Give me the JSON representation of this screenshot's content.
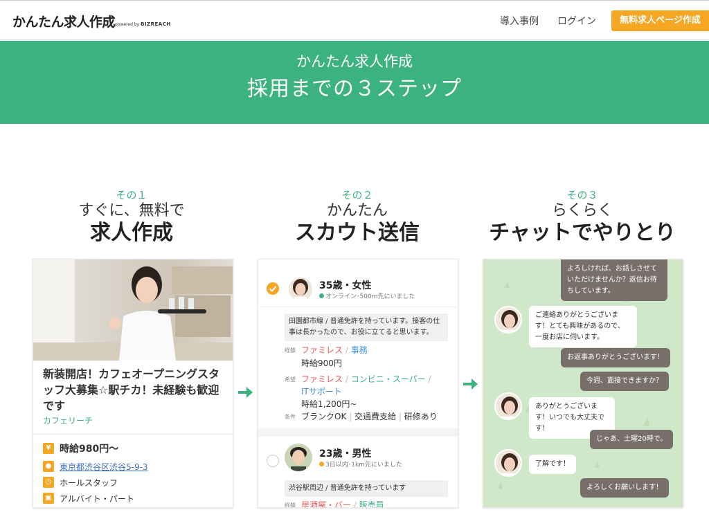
{
  "header": {
    "logo": "かんたん求人作成",
    "logo_powered": "powered by",
    "logo_brand": "BIZREACH",
    "nav_cases": "導入事例",
    "nav_login": "ログイン",
    "cta": "無料求人ページ作成"
  },
  "banner": {
    "subtitle": "かんたん求人作成",
    "title": "採用までの３ステップ"
  },
  "steps": [
    {
      "num": "その１",
      "sub": "すぐに、無料で",
      "main": "求人作成"
    },
    {
      "num": "その２",
      "sub": "かんたん",
      "main": "スカウト送信"
    },
    {
      "num": "その３",
      "sub": "らくらく",
      "main": "チャットでやりとり"
    }
  ],
  "job_card": {
    "title": "新装開店！カフェオープニングスタッフ大募集☆駅チカ！未経験も歓迎です",
    "company": "カフェリーチ",
    "wage": "時給980円〜",
    "address": "東京都渋谷区渋谷5-9-3",
    "position": "ホールスタッフ",
    "employment": "アルバイト・パート",
    "icons": [
      "yen-icon",
      "map-pin-icon",
      "clock-icon",
      "bag-icon"
    ]
  },
  "scout_card": {
    "candidates": [
      {
        "name": "35歳・女性",
        "status": "オンライン･500m先にいました",
        "status_color": "#3cb37f",
        "message": "田園都市線 / 普通免許を持っています。接客の仕事は長かったので、お役に立てると思います。",
        "exp_label": "経験",
        "exp_a": "ファミレス",
        "exp_sep": "/",
        "exp_b": "事務",
        "exp_wage": "時給900円",
        "wish_label": "希望",
        "wish_a": "ファミレス",
        "wish_sep1": "/",
        "wish_b": "コンビニ・スーパー",
        "wish_sep2": "/",
        "wish_c": "ITサポート",
        "wish_wage": "時給1,200円~",
        "cond_label": "条件",
        "cond": "ブランクOK",
        "cond_sep1": "|",
        "cond_b": "交通費支給",
        "cond_sep2": "|",
        "cond_c": "研修あり"
      },
      {
        "name": "23歳・男性",
        "status": "3日以内･1km先にいました",
        "status_color": "#f5a623",
        "message": "渋谷駅周辺 / 普通免許を持っています",
        "exp_label": "経験",
        "exp_a": "居酒屋・バー",
        "exp_sep": "/",
        "exp_b": "販売員"
      }
    ]
  },
  "chat_card": {
    "messages": [
      {
        "side": "right",
        "text": "よろしければ、お話しさせていただけませんか？返信お待ちしています。"
      },
      {
        "side": "left",
        "text": "ご連絡ありがとうございます！とても興味があるので、一度お店に伺います。"
      },
      {
        "side": "right",
        "text": "お返事ありがとうございます！"
      },
      {
        "side": "right",
        "text": "今週、面接できますか？"
      },
      {
        "side": "left",
        "text": "ありがとうございます！いつでも大丈夫です！"
      },
      {
        "side": "right",
        "text": "じゃあ、土曜20時で。"
      },
      {
        "side": "left",
        "text": "了解です！"
      },
      {
        "side": "right",
        "text": "よろしくお願いします！"
      }
    ]
  },
  "colors": {
    "brand_green": "#3cb37f",
    "cta_orange": "#f5a623",
    "chat_bg": "#cfe8c9",
    "bubble_right": "#786f6a"
  }
}
